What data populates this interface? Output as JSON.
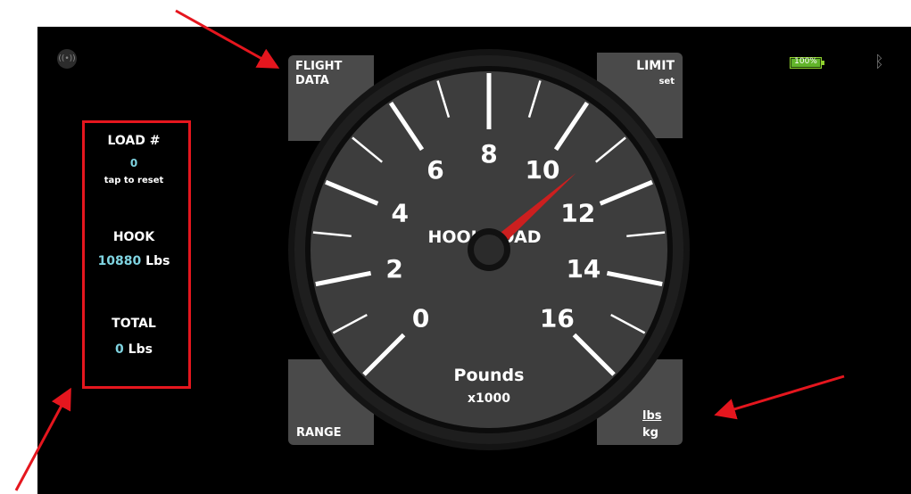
{
  "buttons": {
    "flight_data_line1": "FLIGHT",
    "flight_data_line2": "DATA",
    "limit_label": "LIMIT",
    "limit_sub": "set",
    "range_label": "RANGE",
    "units_top": "lbs",
    "units_bottom": "kg"
  },
  "gauge": {
    "title": "HOOK LOAD",
    "units_label": "Pounds",
    "multiplier": "x1000",
    "scale_labels": [
      "0",
      "2",
      "4",
      "6",
      "8",
      "10",
      "12",
      "14",
      "16"
    ],
    "min": 0,
    "max": 16,
    "needle_value": 10.88,
    "needle_color": "#cc1f1f",
    "dial_color": "#3d3d3d",
    "bezel_color": "#1e1e1e"
  },
  "info_panel": {
    "load_label": "LOAD #",
    "load_value": "0",
    "load_hint": "tap to reset",
    "hook_label": "HOOK",
    "hook_value": "10880",
    "hook_unit": "Lbs",
    "total_label": "TOTAL",
    "total_value": "0",
    "total_unit": "Lbs"
  },
  "status": {
    "battery_text": "100%",
    "battery_level": 1.0,
    "left_icon": "signal-icon",
    "right_icon": "bluetooth-icon"
  },
  "colors": {
    "accent_cyan": "#7fd3e0",
    "annotation_red": "#e5161e"
  }
}
